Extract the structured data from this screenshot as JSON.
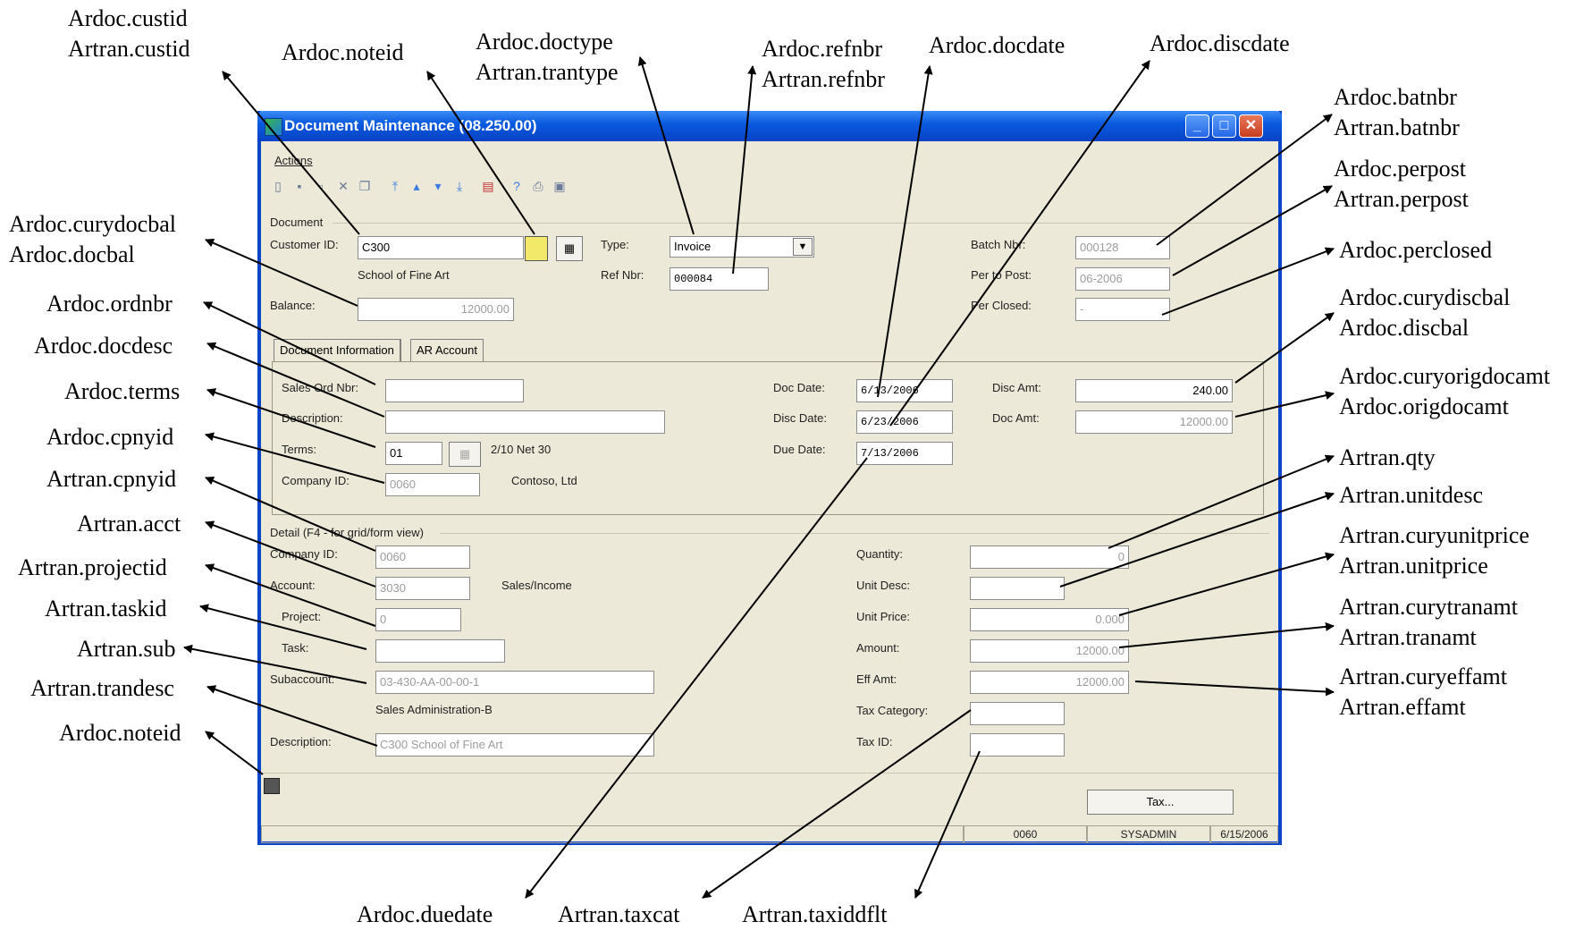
{
  "window": {
    "title": "Document Maintenance (08.250.00)",
    "menu_actions": "Actions",
    "tab_document_information": "Document Information",
    "tab_ar_account": "AR Account",
    "tax_button": "Tax..."
  },
  "document": {
    "section": "Document",
    "customer_id_label": "Customer ID:",
    "customer_id": "C300",
    "customer_name": "School of Fine Art",
    "type_label": "Type:",
    "type": "Invoice",
    "ref_nbr_label": "Ref Nbr:",
    "ref_nbr": "000084",
    "balance_label": "Balance:",
    "balance": "12000.00",
    "batch_nbr_label": "Batch Nbr:",
    "batch_nbr": "000128",
    "per_to_post_label": "Per to Post:",
    "per_to_post": "06-2006",
    "per_closed_label": "Per Closed:",
    "per_closed": "-"
  },
  "doc_info": {
    "sales_ord_label": "Sales Ord Nbr:",
    "sales_ord": "",
    "description_label": "Description:",
    "description": "",
    "terms_label": "Terms:",
    "terms": "01",
    "terms_desc": "2/10 Net 30",
    "company_id_label": "Company ID:",
    "company_id": "0060",
    "company_name": "Contoso, Ltd",
    "doc_date_label": "Doc Date:",
    "doc_date": "6/13/2006",
    "disc_date_label": "Disc Date:",
    "disc_date": "6/23/2006",
    "due_date_label": "Due Date:",
    "due_date": "7/13/2006",
    "disc_amt_label": "Disc Amt:",
    "disc_amt": "240.00",
    "doc_amt_label": "Doc Amt:",
    "doc_amt": "12000.00"
  },
  "detail": {
    "section": "Detail (F4 - for grid/form view)",
    "company_id_label": "Company ID:",
    "company_id": "0060",
    "account_label": "Account:",
    "account": "3030",
    "account_desc": "Sales/Income",
    "project_label": "Project:",
    "project": "0",
    "task_label": "Task:",
    "task": "",
    "subaccount_label": "Subaccount:",
    "subaccount": "03-430-AA-00-00-1",
    "subaccount_desc": "Sales Administration-B",
    "description_label": "Description:",
    "description": "C300 School of Fine Art",
    "quantity_label": "Quantity:",
    "quantity": "0",
    "unit_desc_label": "Unit Desc:",
    "unit_desc": "",
    "unit_price_label": "Unit Price:",
    "unit_price": "0.000",
    "amount_label": "Amount:",
    "amount": "12000.00",
    "eff_amt_label": "Eff Amt:",
    "eff_amt": "12000.00",
    "tax_category_label": "Tax Category:",
    "tax_category": "",
    "tax_id_label": "Tax ID:",
    "tax_id": ""
  },
  "status_bar": {
    "company": "0060",
    "user": "SYSADMIN",
    "date": "6/15/2006"
  },
  "callouts": {
    "custid": [
      "Ardoc.custid",
      "Artran.custid"
    ],
    "noteid_top": [
      "Ardoc.noteid"
    ],
    "doctype": [
      "Ardoc.doctype",
      "Artran.trantype"
    ],
    "refnbr": [
      "Ardoc.refnbr",
      "Artran.refnbr"
    ],
    "docdate": [
      "Ardoc.docdate"
    ],
    "discdate": [
      "Ardoc.discdate"
    ],
    "batnbr": [
      "Ardoc.batnbr",
      "Artran.batnbr"
    ],
    "perpost": [
      "Ardoc.perpost",
      "Artran.perpost"
    ],
    "perclosed": [
      "Ardoc.perclosed"
    ],
    "discbal": [
      "Ardoc.curydiscbal",
      "Ardoc.discbal"
    ],
    "origdocamt": [
      "Ardoc.curyorigdocamt",
      "Ardoc.origdocamt"
    ],
    "qty": [
      "Artran.qty"
    ],
    "unitdesc": [
      "Artran.unitdesc"
    ],
    "unitprice": [
      "Artran.curyunitprice",
      "Artran.unitprice"
    ],
    "tranamt": [
      "Artran.curytranamt",
      "Artran.tranamt"
    ],
    "effamt": [
      "Artran.curyeffamt",
      "Artran.effamt"
    ],
    "docbal": [
      "Ardoc.curydocbal",
      "Ardoc.docbal"
    ],
    "ordnbr": [
      "Ardoc.ordnbr"
    ],
    "docdesc": [
      "Ardoc.docdesc"
    ],
    "terms": [
      "Ardoc.terms"
    ],
    "cpnyid_doc": [
      "Ardoc.cpnyid"
    ],
    "cpnyid_tran": [
      "Artran.cpnyid"
    ],
    "acct": [
      "Artran.acct"
    ],
    "projectid": [
      "Artran.projectid"
    ],
    "taskid": [
      "Artran.taskid"
    ],
    "sub": [
      "Artran.sub"
    ],
    "trandesc": [
      "Artran.trandesc"
    ],
    "noteid_bottom": [
      "Ardoc.noteid"
    ],
    "duedate": [
      "Ardoc.duedate"
    ],
    "taxcat": [
      "Artran.taxcat"
    ],
    "taxiddflt": [
      "Artran.taxiddflt"
    ]
  },
  "icons": [
    "app-icon",
    "minimize-icon",
    "maximize-icon",
    "close-icon",
    "new-icon",
    "save-icon",
    "delete-icon",
    "copy-icon",
    "first-icon",
    "prev-icon",
    "next-icon",
    "last-icon",
    "note-icon",
    "calendar-icon",
    "help-icon",
    "dropdown-icon"
  ]
}
